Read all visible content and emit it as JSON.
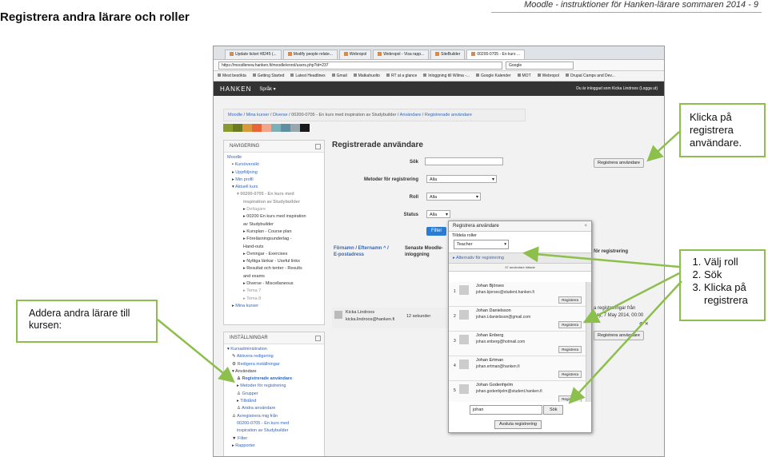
{
  "doc": {
    "title": "Registrera andra lärare och roller",
    "header": "Moodle - instruktioner för Hanken-lärare sommaren 2014 - 9"
  },
  "browser": {
    "tabs": [
      "Update ticket #8245 (...",
      "Modify people relate...",
      "Webropol",
      "Webropol - Visa rapp...",
      "SiteBuilder",
      "00200-0705 - En kurs ..."
    ],
    "url": "https://moodlenew.hanken.fi/moodle/enrol/users.php?id=237",
    "search_placeholder": "Google",
    "bookmarks": [
      "Mest besökta",
      "Getting Started",
      "Latest Headlines",
      "Gmail",
      "Matkahuolto",
      "RT at a glance",
      "Inloggning till Wilma -...",
      "Google Kalender",
      "MOT",
      "Webropol",
      "Drupal Camps and Dev..."
    ]
  },
  "moodle": {
    "brand": "HANKEN",
    "lang": "Språk ▾",
    "login": "Du är inloggad som Kicka Lindroos (Logga ut)",
    "breadcrumb": [
      "Moodle",
      "Mina kurser",
      "Diverse",
      "00200-0705 - En kurs med inspiration av Studybuilder",
      "Användare",
      "Registrerade användare"
    ],
    "swatches": [
      "#8a9a2e",
      "#6b7b1e",
      "#d89a3a",
      "#e8653a",
      "#f2a68a",
      "#7ab0b8",
      "#5f8fa0",
      "#9aa8ae",
      "#1a1a1a"
    ],
    "nav": {
      "title": "NAVIGERING",
      "items": [
        "Moodle",
        "Kursöversikt",
        "Uppföljning",
        "Min profil",
        "Aktuell kurs",
        "00200-0705 - En kurs med",
        "inspiration av Studybuilder",
        "Deltagare",
        "00200 En kurs med inspiration",
        "av Studybuilder",
        "Kursplan - Course plan",
        "Föreläsningsunderlag -",
        "Hand-outs",
        "Övningar - Exercises",
        "Nyttiga länkar - Useful links",
        "Resultat och tenter - Results",
        "and exams",
        "Diverse - Miscellaneous",
        "Tema 7",
        "Tema 8",
        "Mina kurser"
      ]
    },
    "settings": {
      "title": "INSTÄLLNINGAR",
      "items": [
        "Kursadministration",
        "Aktivera redigering",
        "Redigera inställningar",
        "Användare",
        "Registrerade användare",
        "Metoder för registrering",
        "Grupper",
        "Tillstånd",
        "Andra användare",
        "Avregistrera mig från",
        "00200-0705 - En kurs med",
        "inspiration av Studybuilder",
        "Filter",
        "Rapporter"
      ]
    },
    "main": {
      "title": "Registrerade användare",
      "sok": "Sök",
      "metoder": "Metoder för registrering",
      "metoder_val": "Alla",
      "roll": "Roll",
      "roll_val": "Alla",
      "status": "Status",
      "status_val": "Alla",
      "filter": "Filter",
      "registrera_btn": "Registrera användare",
      "col1_a": "Förnamn / Efternamn",
      "col1_sort": "^ /",
      "col1_b": "E-postadress",
      "col2_a": "Senaste Moodle-",
      "col2_b": "inloggning",
      "col3": "för registrering",
      "user_name": "Kicka Lindroos",
      "user_email": "kicka.lindroos@hanken.fi",
      "user_login": "12 sekunder",
      "behind1": "a registreringar från",
      "behind2": "day, 7 May 2014, 00:00",
      "behind3": "⊕ ✕",
      "registrera_btn2": "Registrera användare"
    },
    "modal": {
      "title": "Registrera användare",
      "close": "×",
      "role_label": "Tilldela roller",
      "role_value": "Teacher",
      "options": "Alternativ för registrering",
      "count": "37 användare hittade",
      "candidates": [
        {
          "num": "1",
          "name": "Johan Björses",
          "email": "johan.bjorses@student.hanken.fi",
          "btn": "Registrera"
        },
        {
          "num": "2",
          "name": "Johan Danielsson",
          "email": "johan.t.danielsson@gmail.com",
          "btn": "Registrera"
        },
        {
          "num": "3",
          "name": "Johan Enberg",
          "email": "johan.enberg@hotmail.com",
          "btn": "Registrera"
        },
        {
          "num": "4",
          "name": "Johan Ertman",
          "email": "johan.ertman@hanken.fi",
          "btn": "Registrera"
        },
        {
          "num": "5",
          "name": "Johan Godenhjelm",
          "email": "johan.godenhjelm@student.hanken.fi",
          "btn": "Registrera"
        }
      ],
      "search_value": "johan",
      "search_btn": "Sök",
      "close_btn": "Avsluta registrering"
    }
  },
  "callouts": {
    "c1": "Klicka på registrera användare.",
    "c2": "Addera andra lärare till kursen:",
    "c3": [
      "Välj roll",
      "Sök",
      "Klicka på registrera"
    ]
  },
  "colors": {
    "callout_border": "#8cbf4c",
    "moodle_nav": "#333333",
    "filter_button": "#2a7bd2"
  }
}
